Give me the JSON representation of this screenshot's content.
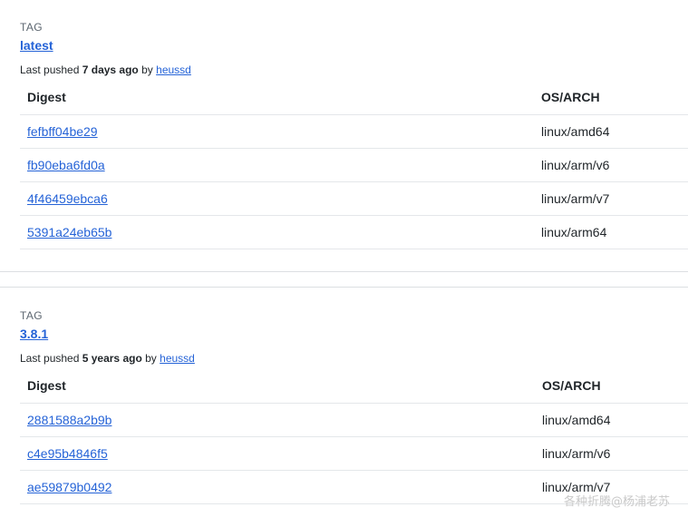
{
  "tags": [
    {
      "label": "TAG",
      "name": "latest",
      "pushed_prefix": "Last pushed",
      "pushed_age": "7 days ago",
      "pushed_by_word": "by",
      "pushed_user": "heussd",
      "columns": {
        "digest": "Digest",
        "arch": "OS/ARCH"
      },
      "rows": [
        {
          "digest": "fefbff04be29",
          "arch": "linux/amd64"
        },
        {
          "digest": "fb90eba6fd0a",
          "arch": "linux/arm/v6"
        },
        {
          "digest": "4f46459ebca6",
          "arch": "linux/arm/v7"
        },
        {
          "digest": "5391a24eb65b",
          "arch": "linux/arm64"
        }
      ]
    },
    {
      "label": "TAG",
      "name": "3.8.1",
      "pushed_prefix": "Last pushed",
      "pushed_age": "5 years ago",
      "pushed_by_word": "by",
      "pushed_user": "heussd",
      "columns": {
        "digest": "Digest",
        "arch": "OS/ARCH"
      },
      "rows": [
        {
          "digest": "2881588a2b9b",
          "arch": "linux/amd64"
        },
        {
          "digest": "c4e95b4846f5",
          "arch": "linux/arm/v6"
        },
        {
          "digest": "ae59879b0492",
          "arch": "linux/arm/v7"
        }
      ]
    }
  ],
  "watermark": "各种折腾@杨浦老苏",
  "colors": {
    "link": "#2563d7",
    "divider": "#dcdfe2",
    "row_border": "#e4e7ea"
  }
}
